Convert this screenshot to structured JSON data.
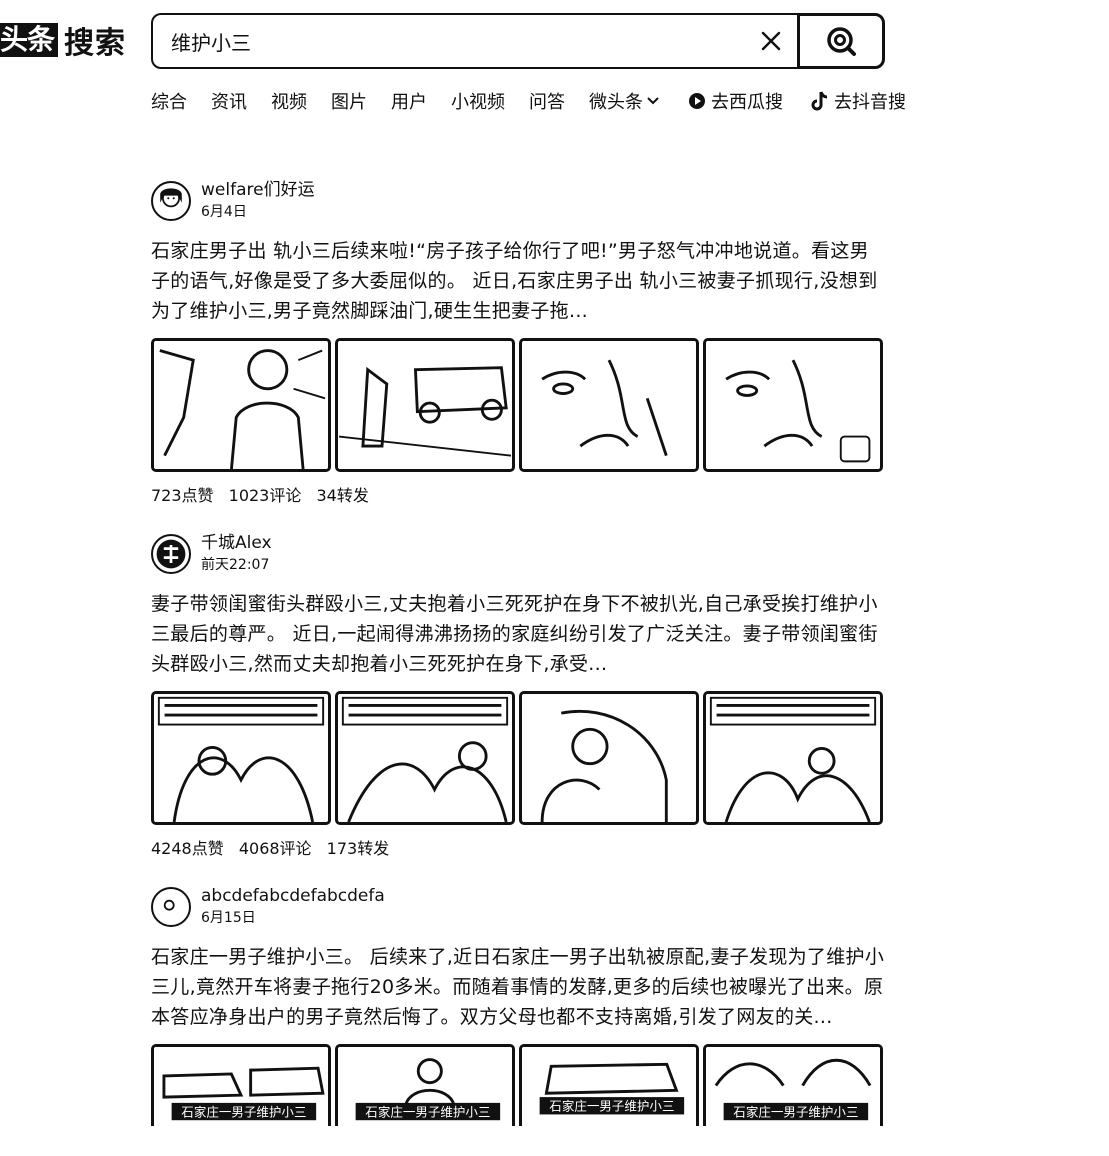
{
  "logo": {
    "box": "头条",
    "text": "搜索"
  },
  "search": {
    "value": "维护小三",
    "placeholder": ""
  },
  "tabs": [
    {
      "label": "综合"
    },
    {
      "label": "资讯"
    },
    {
      "label": "视频"
    },
    {
      "label": "图片"
    },
    {
      "label": "用户"
    },
    {
      "label": "小视频"
    },
    {
      "label": "问答"
    },
    {
      "label": "微头条"
    },
    {
      "label": "去西瓜搜"
    },
    {
      "label": "去抖音搜"
    }
  ],
  "posts": [
    {
      "author": "welfare们好运",
      "time": "6月4日",
      "summary": "石家庄男子出 轨小三后续来啦!“房子孩子给你行了吧!”男子怒气冲冲地说道。看这男子的语气,好像是受了多大委屈似的。 近日,石家庄男子出 轨小三被妻子抓现行,没想到为了维护小三,男子竟然脚踩油门,硬生生把妻子拖...",
      "stats": {
        "likes": "723点赞",
        "comments": "1023评论",
        "shares": "34转发"
      }
    },
    {
      "author": "千城Alex",
      "time": "前天22:07",
      "summary": "妻子带领闺蜜街头群殴小三,丈夫抱着小三死死护在身下不被扒光,自己承受挨打维护小三最后的尊严。 近日,一起闹得沸沸扬扬的家庭纠纷引发了广泛关注。妻子带领闺蜜街头群殴小三,然而丈夫却抱着小三死死护在身下,承受...",
      "stats": {
        "likes": "4248点赞",
        "comments": "4068评论",
        "shares": "173转发"
      }
    },
    {
      "author": "abcdefabcdefabcdefa",
      "time": "6月15日",
      "summary": "石家庄一男子维护小三。 后续来了,近日石家庄一男子出轨被原配,妻子发现为了维护小三儿,竟然开车将妻子拖行20多米。而随着事情的发酵,更多的后续也被曝光了出来。原本答应净身出户的男子竟然后悔了。双方父母也都不支持离婚,引发了网友的关...",
      "captions": [
        "石家庄一男子维护小三",
        "石家庄一男子维护小三",
        "石家庄一男子维护小三",
        "石家庄一男子维护小三"
      ]
    }
  ]
}
